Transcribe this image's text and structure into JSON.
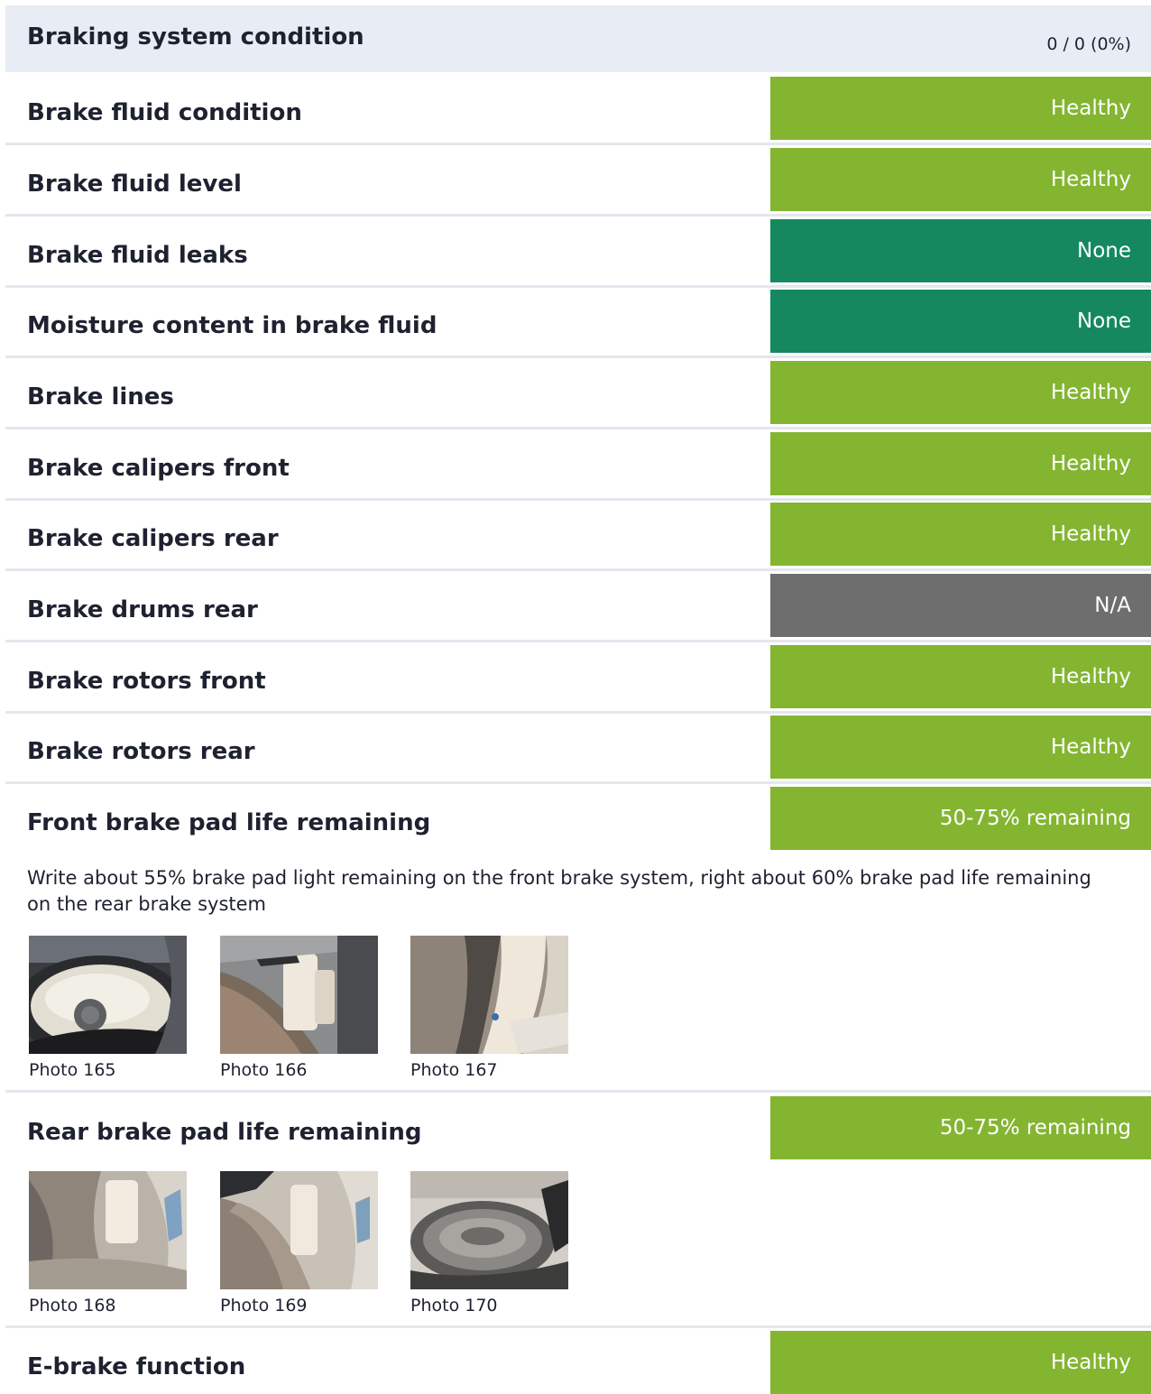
{
  "header": {
    "title": "Braking system condition",
    "score": "0 / 0 (0%)"
  },
  "colors": {
    "healthy": "#84b531",
    "none": "#158860",
    "na": "#6e6e6e",
    "header_bg": "#e8edf5"
  },
  "items": [
    {
      "label": "Brake fluid condition",
      "status": "Healthy"
    },
    {
      "label": "Brake fluid level",
      "status": "Healthy"
    },
    {
      "label": "Brake fluid leaks",
      "status": "None"
    },
    {
      "label": "Moisture content in brake fluid",
      "status": "None"
    },
    {
      "label": "Brake lines",
      "status": "Healthy"
    },
    {
      "label": "Brake calipers front",
      "status": "Healthy"
    },
    {
      "label": "Brake calipers rear",
      "status": "Healthy"
    },
    {
      "label": "Brake drums rear",
      "status": "N/A"
    },
    {
      "label": "Brake rotors front",
      "status": "Healthy"
    },
    {
      "label": "Brake rotors rear",
      "status": "Healthy"
    },
    {
      "label": "Front brake pad life remaining",
      "status": "50-75% remaining"
    },
    {
      "label": "Rear brake pad life remaining",
      "status": "50-75% remaining"
    },
    {
      "label": "E-brake function",
      "status": "Healthy"
    }
  ],
  "front_pad_note": "Write about 55% brake pad light remaining on the front brake system, right about 60% brake pad life remaining on the rear brake system",
  "front_photos": [
    {
      "caption": "Photo 165"
    },
    {
      "caption": "Photo 166"
    },
    {
      "caption": "Photo 167"
    }
  ],
  "rear_photos": [
    {
      "caption": "Photo 168"
    },
    {
      "caption": "Photo 169"
    },
    {
      "caption": "Photo 170"
    }
  ]
}
